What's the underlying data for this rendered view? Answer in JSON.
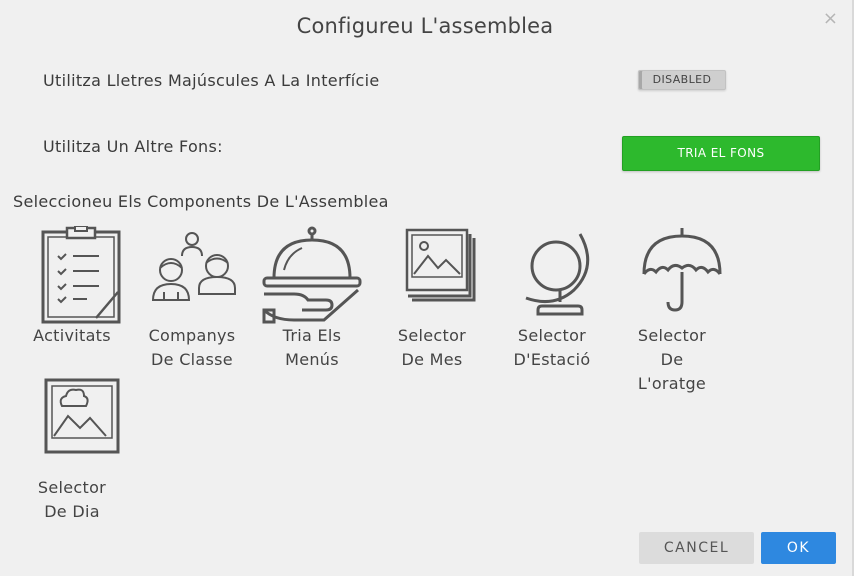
{
  "dialog": {
    "title": "Configureu L'assemblea",
    "close_glyph": "×"
  },
  "options": {
    "uppercase_label": "Utilitza Lletres Majúscules A La Interfície",
    "uppercase_toggle": "DISABLED",
    "background_label": "Utilitza Un Altre Fons:",
    "background_button": "TRIA EL FONS"
  },
  "components": {
    "section_title": "Seleccioneu Els Components De L'Assemblea",
    "items": [
      {
        "line1": "Activitats",
        "line2": "",
        "line3": "",
        "icon": "clipboard-checklist-icon"
      },
      {
        "line1": "Companys",
        "line2": "De Classe",
        "line3": "",
        "icon": "classmates-icon"
      },
      {
        "line1": "Tria Els",
        "line2": "Menús",
        "line3": "",
        "icon": "serving-cloche-icon"
      },
      {
        "line1": "Selector",
        "line2": "De Mes",
        "line3": "",
        "icon": "photo-stack-icon"
      },
      {
        "line1": "Selector",
        "line2": "D'Estació",
        "line3": "",
        "icon": "globe-icon"
      },
      {
        "line1": "Selector",
        "line2": "De",
        "line3": "L'oratge",
        "icon": "umbrella-icon"
      },
      {
        "line1": "Selector",
        "line2": "De Dia",
        "line3": "",
        "icon": "landscape-picture-icon"
      }
    ]
  },
  "footer": {
    "cancel_label": "CANCEL",
    "ok_label": "OK"
  },
  "colors": {
    "background": "#f0f0f0",
    "green_button": "#2db92d",
    "ok_button": "#2e88e0",
    "cancel_button": "#dcdcdc",
    "icon_stroke": "#555555"
  }
}
